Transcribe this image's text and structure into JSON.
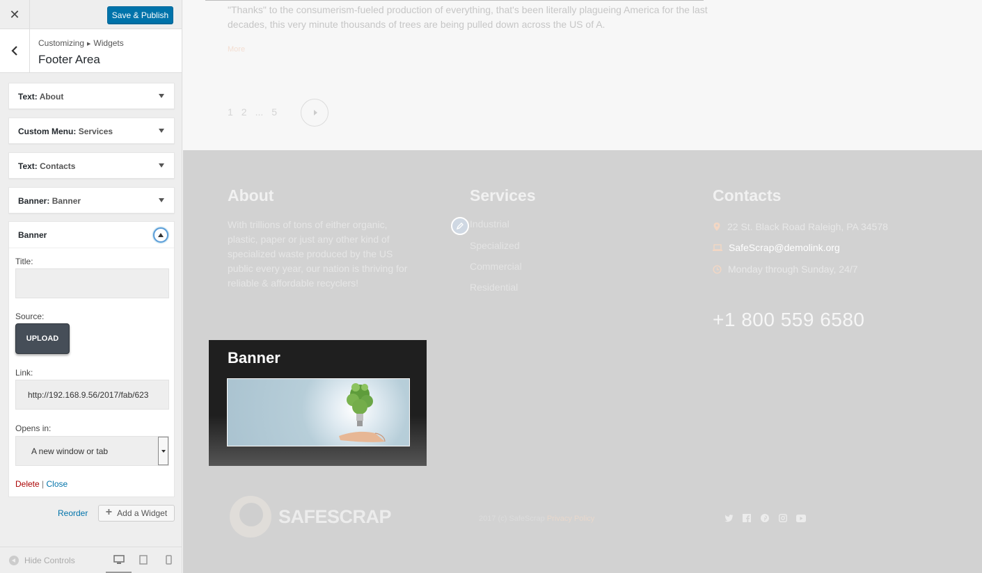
{
  "sidebar": {
    "close_symbol": "✕",
    "publish_label": "Save & Publish",
    "breadcrumb": {
      "root": "Customizing",
      "child": "Widgets"
    },
    "section_title": "Footer Area",
    "widgets": [
      {
        "type": "Text",
        "sep": ":",
        "name": "About"
      },
      {
        "type": "Custom Menu",
        "sep": ":",
        "name": "Services"
      },
      {
        "type": "Text",
        "sep": ":",
        "name": "Contacts"
      },
      {
        "type": "Banner",
        "sep": ":",
        "name": "Banner"
      }
    ],
    "open_widget": {
      "title": "Banner",
      "fields": {
        "title_label": "Title:",
        "title_value": "",
        "source_label": "Source:",
        "upload_label": "UPLOAD",
        "link_label": "Link:",
        "link_value": "http://192.168.9.56/2017/fab/623",
        "opens_label": "Opens in:",
        "opens_value": "A new window or tab"
      },
      "delete_label": "Delete",
      "divider": "|",
      "close_label": "Close"
    },
    "reorder_label": "Reorder",
    "add_widget_label": "Add a Widget",
    "hide_controls_label": "Hide Controls",
    "devices": [
      "desktop-icon",
      "tablet-icon",
      "mobile-icon"
    ]
  },
  "preview": {
    "article_text": "\"Thanks\" to the consumerism-fueled production of everything, that's been literally plagueing America for the last decades, this very minute thousands of trees are being pulled down across the US of A.",
    "more_label": "More",
    "pages": [
      "1",
      "2",
      "...",
      "5"
    ],
    "footer": {
      "about": {
        "title": "About",
        "text": "With trillions of tons of either organic, plastic, paper or just any other kind of specialized waste produced by the US public every year, our nation is thriving for reliable & affordable recyclers!"
      },
      "services": {
        "title": "Services",
        "items": [
          "Industrial",
          "Specialized",
          "Commercial",
          "Residential"
        ]
      },
      "contacts": {
        "title": "Contacts",
        "address": "22 St. Black Road Raleigh, PA 34578",
        "email": "SafeScrap@demolink.org",
        "hours": "Monday through Sunday, 24/7",
        "phone": "+1 800 559 6580"
      },
      "banner": {
        "title": "Banner"
      },
      "logo_text": "SAFESCRAP",
      "copyright": "2017 (c) SafeScrap",
      "privacy_label": "Privacy Policy",
      "socials": [
        "twitter-icon",
        "facebook-icon",
        "pinterest-icon",
        "instagram-icon",
        "youtube-icon"
      ]
    }
  },
  "colors": {
    "accent": "#0073aa",
    "delete": "#aa0000",
    "footer_bg": "#d2d2d2"
  }
}
